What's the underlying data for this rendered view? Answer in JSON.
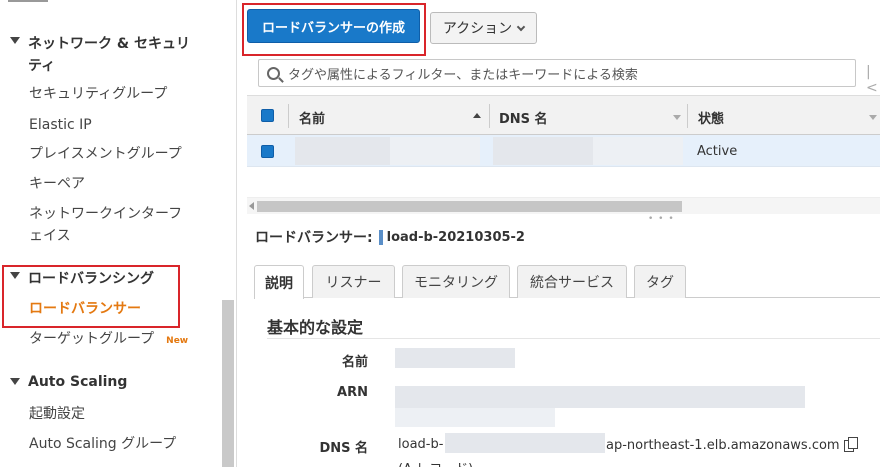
{
  "sidebar": {
    "groups": [
      {
        "label": "ネットワーク & セキュリティ"
      },
      {
        "label": "ロードバランシング"
      },
      {
        "label": "Auto Scaling"
      }
    ],
    "items": [
      {
        "label": "セキュリティグループ"
      },
      {
        "label": "Elastic IP"
      },
      {
        "label": "プレイスメントグループ"
      },
      {
        "label": "キーペア"
      },
      {
        "label": "ネットワークインターフェイス"
      },
      {
        "label": "ロードバランサー"
      },
      {
        "label": "ターゲットグループ",
        "badge": "New"
      },
      {
        "label": "起動設定"
      },
      {
        "label": "Auto Scaling グループ"
      }
    ]
  },
  "toolbar": {
    "create_label": "ロードバランサーの作成",
    "actions_label": "アクション"
  },
  "search": {
    "placeholder": "タグや属性によるフィルター、またはキーワードによる検索"
  },
  "table": {
    "columns": [
      "名前",
      "DNS 名",
      "状態"
    ],
    "rows": [
      {
        "name": "",
        "dns": "",
        "state": "Active"
      }
    ]
  },
  "detail": {
    "title_label": "ロードバランサー:",
    "lb_name": "load-b-20210305-2",
    "tabs": [
      "説明",
      "リスナー",
      "モニタリング",
      "統合サービス",
      "タグ"
    ],
    "section_title": "基本的な設定",
    "fields": {
      "name_label": "名前",
      "arn_label": "ARN",
      "dns_label": "DNS 名",
      "dns_prefix": "load-b-",
      "dns_suffix": "ap-northeast-1.elb.amazonaws.com",
      "dns_note": "(A レコード)"
    }
  },
  "colors": {
    "primary_button": "#1979c9",
    "active_nav": "#e47911",
    "highlight_box": "#d9252a",
    "selected_row": "#e6f0fb"
  }
}
